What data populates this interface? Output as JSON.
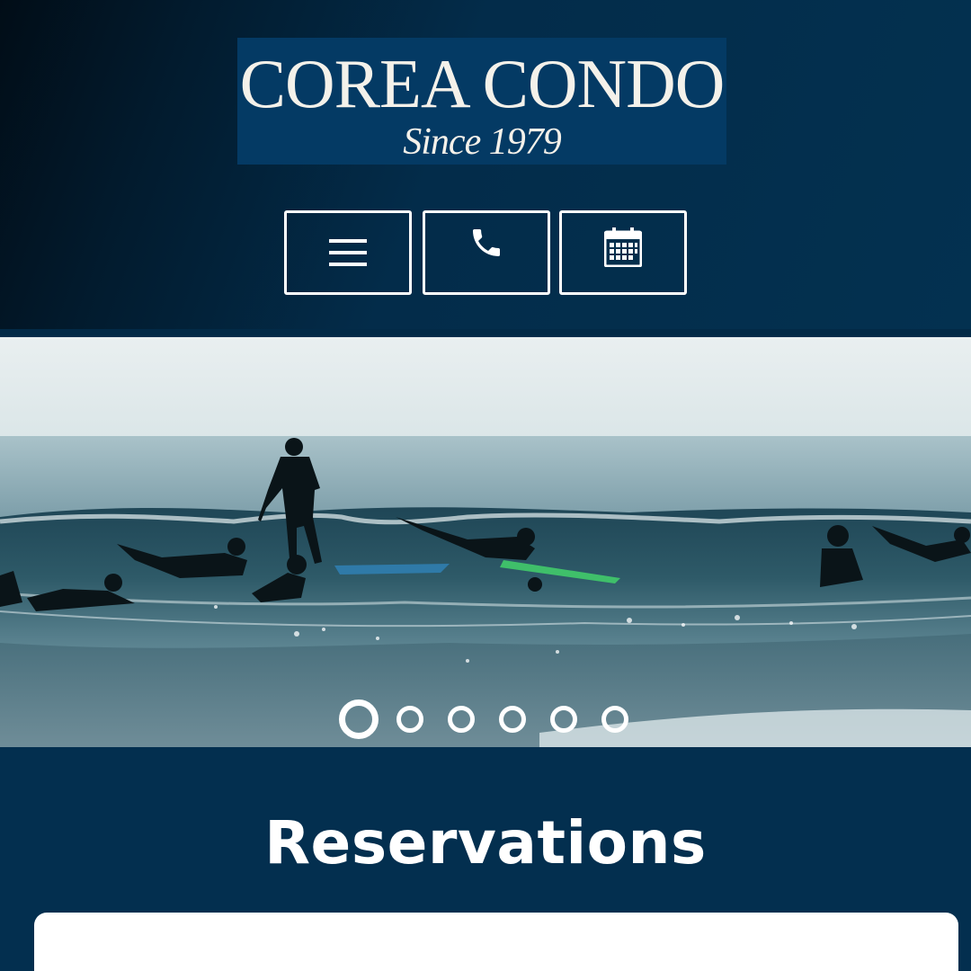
{
  "brand": {
    "name": "COREA CONDO",
    "tagline": "Since 1979"
  },
  "nav": {
    "menu_icon": "hamburger-menu-icon",
    "phone_icon": "phone-icon",
    "calendar_icon": "calendar-icon"
  },
  "hero": {
    "image": "surfers-in-ocean-waves",
    "slide_count": 6,
    "active_slide": 1
  },
  "reservations": {
    "title": "Reservations"
  },
  "colors": {
    "navy": "#032f4f",
    "logo_bg": "#043a64",
    "text_light": "#ffffff"
  }
}
